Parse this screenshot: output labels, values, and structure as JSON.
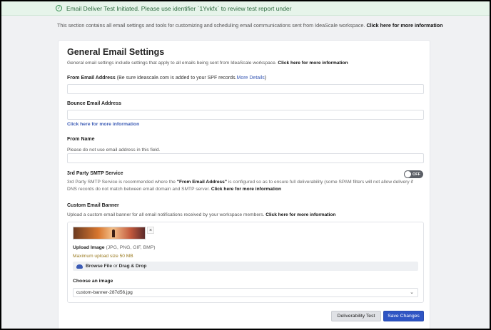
{
  "banner": {
    "message": "Email Deliver Test Initiated. Please use identifier `1Yvkfx` to review test report under",
    "icon": "check-circle-icon",
    "color": "#2e6b40"
  },
  "intro": {
    "text": "This section contains all email settings and tools for customizing and scheduling email communications sent from IdeaScale workspace.",
    "link": "Click here for more information"
  },
  "card": {
    "title": "General Email Settings",
    "subtitle": "General email settings include settings that apply to all emails being sent from IdeaScale workspace.",
    "subtitle_link": "Click here for more information"
  },
  "from_email": {
    "label": "From Email Address",
    "hint": "(Be sure ideascale.com is added to your SPF records.",
    "hint_link": "More Details",
    "hint_close": ")",
    "value": ""
  },
  "bounce_email": {
    "label": "Bounce Email Address",
    "value": "",
    "link": "Click here for more information"
  },
  "from_name": {
    "label": "From Name",
    "hint": "Please do not use email address in this field.",
    "value": ""
  },
  "smtp": {
    "label": "3rd Party SMTP Service",
    "toggle_text": "OFF",
    "desc_pre": "3rd Party SMTP Service is recommended where the",
    "desc_bold": "\"From Email Address\"",
    "desc_post": "is configured so as to ensure full deliverability (some SPAM filters will not allow delivery if DNS records do not match between email domain and SMTP server.",
    "desc_link": "Click here for more information"
  },
  "banner_upload": {
    "label": "Custom Email Banner",
    "desc": "Upload a custom email banner for all email notifications received by your workspace members.",
    "desc_link": "Click here for more information",
    "remove": "×",
    "upload_label": "Upload Image",
    "upload_types": "(JPG, PNG, GIF, BMP)",
    "max_size": "Maximum upload size 50 MB",
    "browse": "Browse File",
    "or": "or",
    "drag": "Drag & Drop",
    "choose_label": "Choose an image",
    "selected": "custom-banner-287d56.jpg",
    "chevron": "⌄"
  },
  "actions": {
    "deliverability": "Deliverability Test",
    "save": "Save Changes",
    "primary_color": "#2f55c4"
  }
}
